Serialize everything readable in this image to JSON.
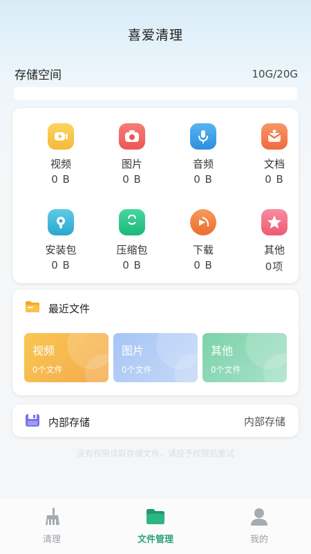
{
  "app": {
    "title": "喜爱清理"
  },
  "storage": {
    "label": "存储空间",
    "value": "10G/20G",
    "used_fraction": 0.0
  },
  "categories": [
    {
      "label": "视频",
      "size": "0 B",
      "icon": "video-icon",
      "color": "#f6c548"
    },
    {
      "label": "图片",
      "size": "0 B",
      "icon": "camera-icon",
      "color": "#f2655e"
    },
    {
      "label": "音频",
      "size": "0 B",
      "icon": "microphone-icon",
      "color": "#3a9ee6"
    },
    {
      "label": "文档",
      "size": "0 B",
      "icon": "document-icon",
      "color": "#f37e52"
    },
    {
      "label": "安装包",
      "size": "0 B",
      "icon": "package-icon",
      "color": "#35b6d8"
    },
    {
      "label": "压缩包",
      "size": "0 B",
      "icon": "zip-bag-icon",
      "color": "#2cc78a"
    },
    {
      "label": "下载",
      "size": "0 B",
      "icon": "download-icon",
      "color": "#f07d3c"
    },
    {
      "label": "其他",
      "size": "0项",
      "icon": "star-icon",
      "color": "#f26d82"
    }
  ],
  "recent": {
    "title": "最近文件",
    "icon": "folder-icon",
    "tiles": [
      {
        "name": "视频",
        "count": "0个文件",
        "color_from": "#f9c44e",
        "color_to": "#f5a94f"
      },
      {
        "name": "图片",
        "count": "0个文件",
        "color_from": "#a9c8f6",
        "color_to": "#c7daf8"
      },
      {
        "name": "其他",
        "count": "0个文件",
        "color_from": "#7fd3ae",
        "color_to": "#a8e2c6"
      }
    ]
  },
  "internal": {
    "title": "内部存储",
    "value": "内部存储",
    "icon": "sd-card-icon"
  },
  "note": "没有权限读取存储文件，请授予权限后重试",
  "tabs": [
    {
      "label": "清理",
      "icon": "broom-icon",
      "active": false
    },
    {
      "label": "文件管理",
      "icon": "folder-tab-icon",
      "active": true
    },
    {
      "label": "我的",
      "icon": "user-icon",
      "active": false
    }
  ],
  "colors": {
    "accent": "#2aa37a",
    "inactive": "#9aa0a6"
  }
}
